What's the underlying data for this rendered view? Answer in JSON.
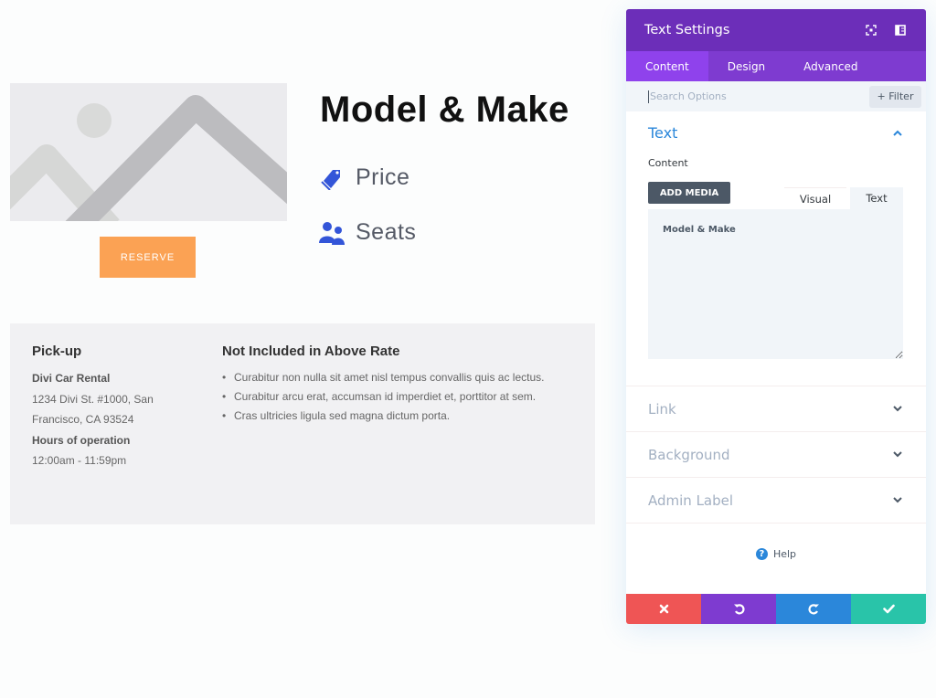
{
  "page": {
    "title": "Model & Make",
    "reserve_label": "RESERVE",
    "features": [
      {
        "icon": "tags-icon",
        "label": "Price"
      },
      {
        "icon": "users-icon",
        "label": "Seats"
      }
    ],
    "pickup": {
      "heading": "Pick-up",
      "company": "Divi Car Rental",
      "address_line1": "1234 Divi St. #1000, San",
      "address_line2": "Francisco, CA 93524",
      "hours_heading": "Hours of operation",
      "hours": "12:00am - 11:59pm"
    },
    "not_included": {
      "heading": "Not Included in Above Rate",
      "items": [
        "Curabitur non nulla sit amet nisl tempus convallis quis ac lectus.",
        "Curabitur arcu erat, accumsan id imperdiet et, porttitor at sem.",
        "Cras ultricies ligula sed magna dictum porta."
      ]
    }
  },
  "panel": {
    "title": "Text Settings",
    "tabs": [
      {
        "label": "Content",
        "active": true
      },
      {
        "label": "Design",
        "active": false
      },
      {
        "label": "Advanced",
        "active": false
      }
    ],
    "search_placeholder": "Search Options",
    "filter_label": "+ Filter",
    "sections": {
      "text": {
        "title": "Text",
        "content_label": "Content",
        "add_media_label": "ADD MEDIA",
        "editor_tabs": [
          "Visual",
          "Text"
        ],
        "editor_value": "Model & Make"
      },
      "closed": [
        {
          "title": "Link"
        },
        {
          "title": "Background"
        },
        {
          "title": "Admin Label"
        }
      ]
    },
    "help_label": "Help",
    "colors": {
      "header": "#6c2eb9",
      "tabs": "#7e3bd0",
      "accent": "#2b87da",
      "cancel": "#ef5555",
      "undo": "#7e3bd0",
      "redo": "#2b87da",
      "save": "#29c4a9",
      "reserve": "#fba254"
    }
  }
}
